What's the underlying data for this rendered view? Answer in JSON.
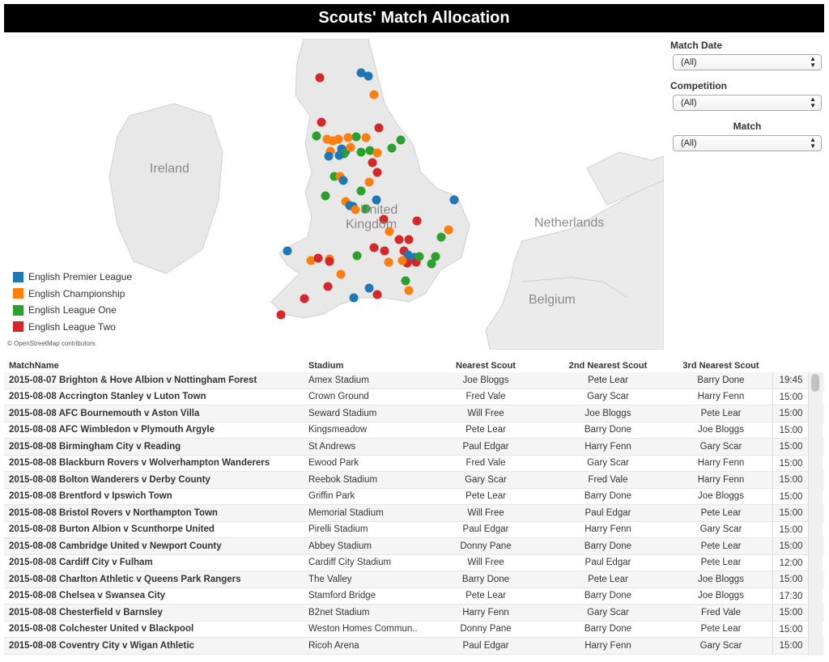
{
  "title": "Scouts' Match Allocation",
  "map": {
    "labels": {
      "ireland": "Ireland",
      "uk_line1": "United",
      "uk_line2": "Kingdom",
      "netherlands": "Netherlands",
      "belgium": "Belgium"
    },
    "attribution": "© OpenStreetMap contributors",
    "legend": [
      {
        "label": "English Premier League",
        "color": "#1f77b4"
      },
      {
        "label": "English Championship",
        "color": "#ff7f0e"
      },
      {
        "label": "English League One",
        "color": "#2ca02c"
      },
      {
        "label": "English League Two",
        "color": "#d62728"
      }
    ]
  },
  "filters": {
    "match_date": {
      "label": "Match Date",
      "value": "(All)"
    },
    "competition": {
      "label": "Competition",
      "value": "(All)"
    },
    "match": {
      "label": "Match",
      "value": "(All)"
    }
  },
  "table": {
    "headers": {
      "match": "MatchName",
      "stadium": "Stadium",
      "n1": "Nearest Scout",
      "n2": "2nd Nearest Scout",
      "n3": "3rd Nearest Scout"
    },
    "rows": [
      {
        "match": "2015-08-07 Brighton & Hove Albion v Nottingham Forest",
        "stadium": "Amex Stadium",
        "n1": "Joe Bloggs",
        "n2": "Pete Lear",
        "n3": "Barry Done",
        "time": "19:45"
      },
      {
        "match": "2015-08-08 Accrington Stanley v Luton Town",
        "stadium": "Crown Ground",
        "n1": "Fred Vale",
        "n2": "Gary Scar",
        "n3": "Harry Fenn",
        "time": "15:00"
      },
      {
        "match": "2015-08-08 AFC Bournemouth v Aston Villa",
        "stadium": "Seward Stadium",
        "n1": "Will Free",
        "n2": "Joe Bloggs",
        "n3": "Pete Lear",
        "time": "15:00"
      },
      {
        "match": "2015-08-08 AFC Wimbledon v Plymouth Argyle",
        "stadium": "Kingsmeadow",
        "n1": "Pete Lear",
        "n2": "Barry Done",
        "n3": "Joe Bloggs",
        "time": "15:00"
      },
      {
        "match": "2015-08-08 Birmingham City v Reading",
        "stadium": "St Andrews",
        "n1": "Paul Edgar",
        "n2": "Harry Fenn",
        "n3": "Gary Scar",
        "time": "15:00"
      },
      {
        "match": "2015-08-08 Blackburn Rovers v Wolverhampton Wanderers",
        "stadium": "Ewood Park",
        "n1": "Fred Vale",
        "n2": "Gary Scar",
        "n3": "Harry Fenn",
        "time": "15:00"
      },
      {
        "match": "2015-08-08 Bolton Wanderers v Derby County",
        "stadium": "Reebok Stadium",
        "n1": "Gary Scar",
        "n2": "Fred Vale",
        "n3": "Harry Fenn",
        "time": "15:00"
      },
      {
        "match": "2015-08-08 Brentford v Ipswich Town",
        "stadium": "Griffin Park",
        "n1": "Pete Lear",
        "n2": "Barry Done",
        "n3": "Joe Bloggs",
        "time": "15:00"
      },
      {
        "match": "2015-08-08 Bristol Rovers v Northampton Town",
        "stadium": "Memorial Stadium",
        "n1": "Will Free",
        "n2": "Paul Edgar",
        "n3": "Pete Lear",
        "time": "15:00"
      },
      {
        "match": "2015-08-08 Burton Albion v Scunthorpe United",
        "stadium": "Pirelli Stadium",
        "n1": "Paul Edgar",
        "n2": "Harry Fenn",
        "n3": "Gary Scar",
        "time": "15:00"
      },
      {
        "match": "2015-08-08 Cambridge United v Newport County",
        "stadium": "Abbey Stadium",
        "n1": "Donny Pane",
        "n2": "Barry Done",
        "n3": "Pete Lear",
        "time": "15:00"
      },
      {
        "match": "2015-08-08 Cardiff City v Fulham",
        "stadium": "Cardiff City Stadium",
        "n1": "Will Free",
        "n2": "Paul Edgar",
        "n3": "Pete Lear",
        "time": "12:00"
      },
      {
        "match": "2015-08-08 Charlton Athletic v Queens Park Rangers",
        "stadium": "The Valley",
        "n1": "Barry Done",
        "n2": "Pete Lear",
        "n3": "Joe Bloggs",
        "time": "15:00"
      },
      {
        "match": "2015-08-08 Chelsea v Swansea City",
        "stadium": "Stamford Bridge",
        "n1": "Pete Lear",
        "n2": "Barry Done",
        "n3": "Joe Bloggs",
        "time": "17:30"
      },
      {
        "match": "2015-08-08 Chesterfield v Barnsley",
        "stadium": "B2net Stadium",
        "n1": "Harry Fenn",
        "n2": "Gary Scar",
        "n3": "Fred Vale",
        "time": "15:00"
      },
      {
        "match": "2015-08-08 Colchester United v Blackpool",
        "stadium": "Weston Homes Commun..",
        "n1": "Donny Pane",
        "n2": "Barry Done",
        "n3": "Pete Lear",
        "time": "15:00"
      },
      {
        "match": "2015-08-08 Coventry City v Wigan Athletic",
        "stadium": "Ricoh Arena",
        "n1": "Paul Edgar",
        "n2": "Harry Fenn",
        "n3": "Gary Scar",
        "time": "15:00"
      }
    ]
  }
}
